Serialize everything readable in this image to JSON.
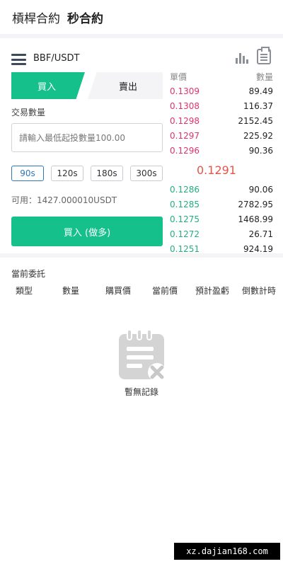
{
  "header": {
    "tabs": [
      {
        "label": "槓桿合約",
        "active": false
      },
      {
        "label": "秒合約",
        "active": true
      }
    ]
  },
  "pair": {
    "name": "BBF/USDT",
    "icons": [
      "menu-icon",
      "chart-icon",
      "clipboard-icon"
    ]
  },
  "trade": {
    "buy_tab": "買入",
    "sell_tab": "賣出",
    "qty_label": "交易數量",
    "qty_value": "",
    "qty_placeholder": "請輸入最低起投數量100.00",
    "durations": [
      "90s",
      "120s",
      "180s",
      "300s"
    ],
    "selected_duration": "90s",
    "available": "可用：1427.000010USDT",
    "buy_button": "買入 (做多)"
  },
  "order_book": {
    "price_header": "單價",
    "qty_header": "數量",
    "asks": [
      {
        "price": "0.1309",
        "qty": "89.49"
      },
      {
        "price": "0.1308",
        "qty": "116.37"
      },
      {
        "price": "0.1298",
        "qty": "2152.45"
      },
      {
        "price": "0.1297",
        "qty": "225.92"
      },
      {
        "price": "0.1296",
        "qty": "90.36"
      }
    ],
    "last_price": "0.1291",
    "bids": [
      {
        "price": "0.1286",
        "qty": "90.06"
      },
      {
        "price": "0.1285",
        "qty": "2782.95"
      },
      {
        "price": "0.1275",
        "qty": "1468.99"
      },
      {
        "price": "0.1272",
        "qty": "26.71"
      },
      {
        "price": "0.1251",
        "qty": "924.19"
      }
    ],
    "colors": {
      "ask": "#e0336a",
      "bid": "#22b07c",
      "last": "#e6534b"
    }
  },
  "orders": {
    "title": "當前委託",
    "columns": [
      "類型",
      "數量",
      "購買價",
      "當前價",
      "預計盈虧",
      "倒數計時"
    ],
    "empty_text": "暫無記錄"
  },
  "watermark": "xz.dajian168.com",
  "colors": {
    "accent": "#15c08a",
    "duration_active": "#2f78b5"
  }
}
